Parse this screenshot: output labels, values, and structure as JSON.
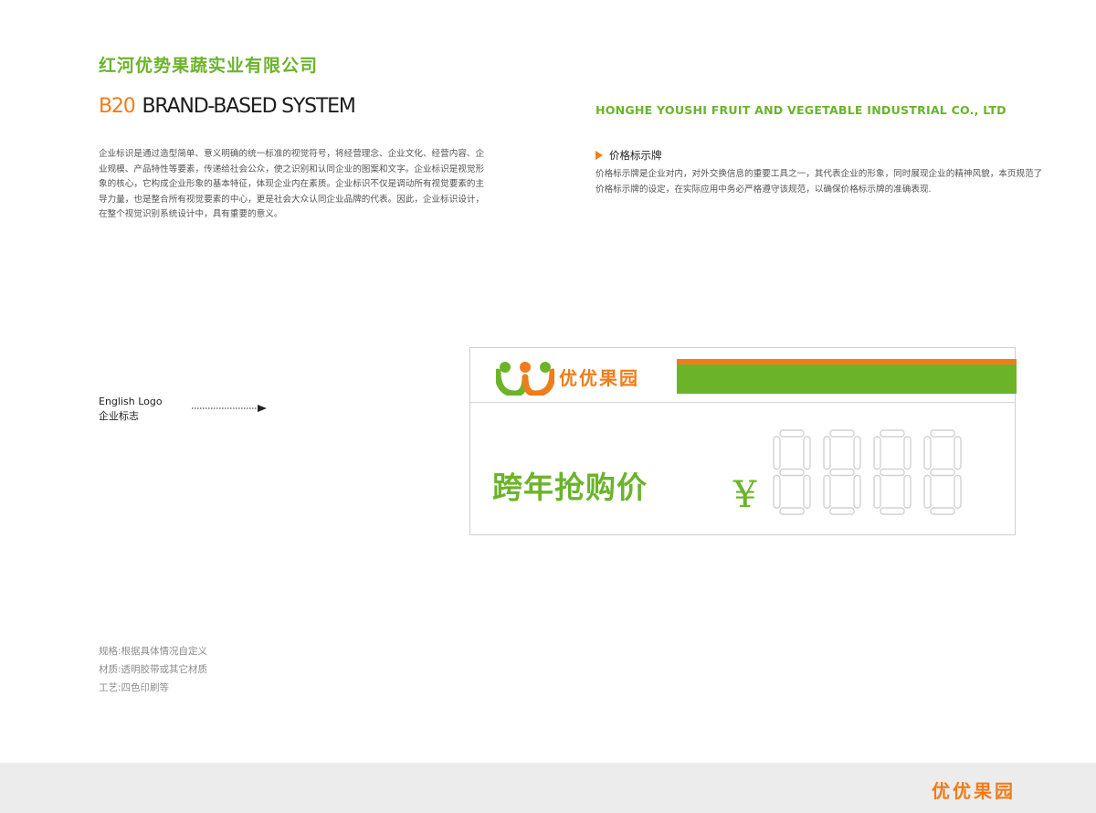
{
  "header": {
    "company_cn": "红河优势果蔬实业有限公司",
    "code": "B20",
    "system": "BRAND-BASED SYSTEM",
    "company_en": "HONGHE YOUSHI FRUIT AND VEGETABLE INDUSTRIAL CO., LTD"
  },
  "intro": "企业标识是通过造型简单、意义明确的统一标准的视觉符号，将经营理念、企业文化、经营内容、企业规模、产品特性等要素，传递给社会公众，使之识别和认同企业的图案和文字。企业标识是视觉形象的核心，它构成企业形象的基本特征，体现企业内在素质。企业标识不仅是调动所有视觉要素的主导力量，也是整合所有视觉要素的中心，更是社会大众认同企业品牌的代表。因此，企业标识设计，在整个视觉识别系统设计中，具有重要的意义。",
  "section": {
    "title": "价格标示牌",
    "desc": "价格标示牌是企业对内，对外交换信息的重要工具之一，其代表企业的形象，同时展现企业的精神风貌，本页规范了价格标示牌的设定，在实际应用中务必严格遵守该规范，以确保价格标示牌的准确表现."
  },
  "logo_label": {
    "en": "English Logo",
    "cn": "企业标志"
  },
  "specs": [
    "规格:根据具体情况自定义",
    "材质:透明胶带或其它材质",
    "工艺:四色印刷等"
  ],
  "sign": {
    "logo_text": "优优果园",
    "promo": "跨年抢购价",
    "currency": "¥",
    "digit_count": 4
  },
  "footer": {
    "logo_text": "优优果园"
  },
  "colors": {
    "green": "#6bb42a",
    "orange": "#ef7d1a",
    "footer_gray": "#ececec"
  }
}
